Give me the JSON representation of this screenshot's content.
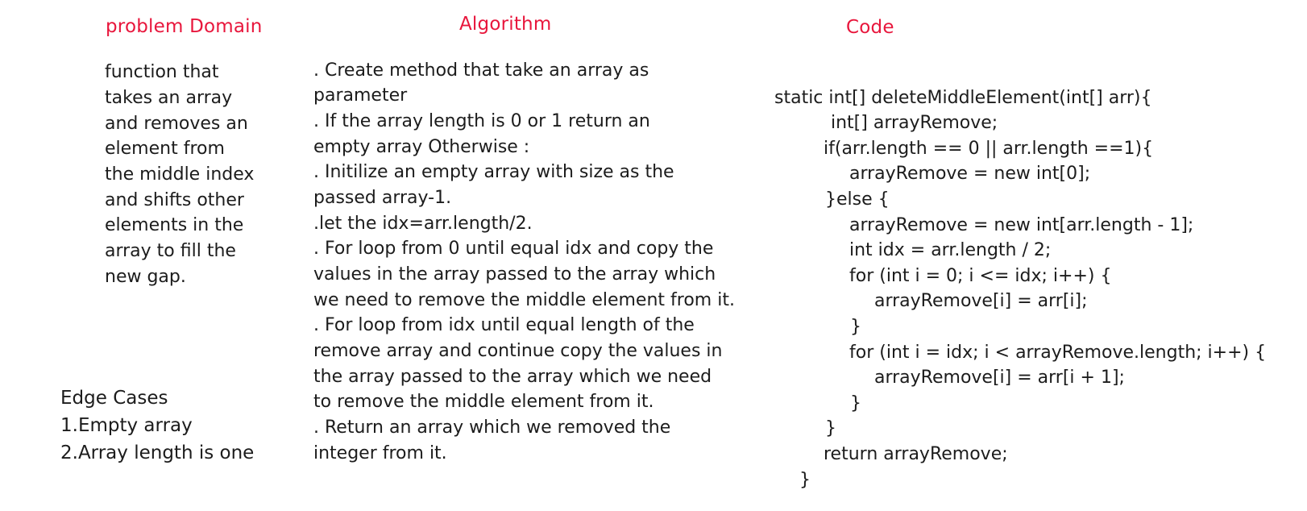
{
  "headings": {
    "problem_domain": "problem Domain",
    "algorithm": "Algorithm",
    "code": "Code"
  },
  "problem_domain": {
    "lines": [
      "function that",
      "takes an array",
      "and removes an",
      "element from",
      "the middle index",
      "and shifts other",
      "elements in the",
      "array to fill the",
      "new gap."
    ]
  },
  "edge_cases": {
    "lines": [
      "Edge Cases",
      "1.Empty array",
      "2.Array length is one"
    ]
  },
  "algorithm": {
    "lines": [
      ". Create method that take an array as",
      "parameter",
      ". If the array length is 0 or 1 return an",
      "empty array Otherwise :",
      ". Initilize an empty array with size as the",
      "passed array-1.",
      ".let the idx=arr.length/2.",
      ". For loop from 0 until equal idx and copy the",
      "values in the array passed to the array which",
      "we need to remove the middle element from it.",
      ". For loop from idx until equal length of the",
      "remove array and continue copy the values in",
      "the array passed to the array which we need",
      "to remove the middle element from it.",
      ". Return an array which we removed the",
      "integer from it."
    ]
  },
  "code": {
    "lines": [
      "static int[] deleteMiddleElement(int[] arr){",
      "int[] arrayRemove;",
      "if(arr.length == 0 || arr.length ==1){",
      "arrayRemove = new int[0];",
      "}else {",
      "arrayRemove = new int[arr.length - 1];",
      "int idx = arr.length / 2;",
      "for (int i = 0; i <= idx; i++) {",
      "arrayRemove[i] = arr[i];",
      "}",
      "for (int i = idx; i < arrayRemove.length; i++) {",
      "arrayRemove[i] = arr[i + 1];",
      "}",
      "}",
      "return arrayRemove;",
      "}"
    ]
  }
}
